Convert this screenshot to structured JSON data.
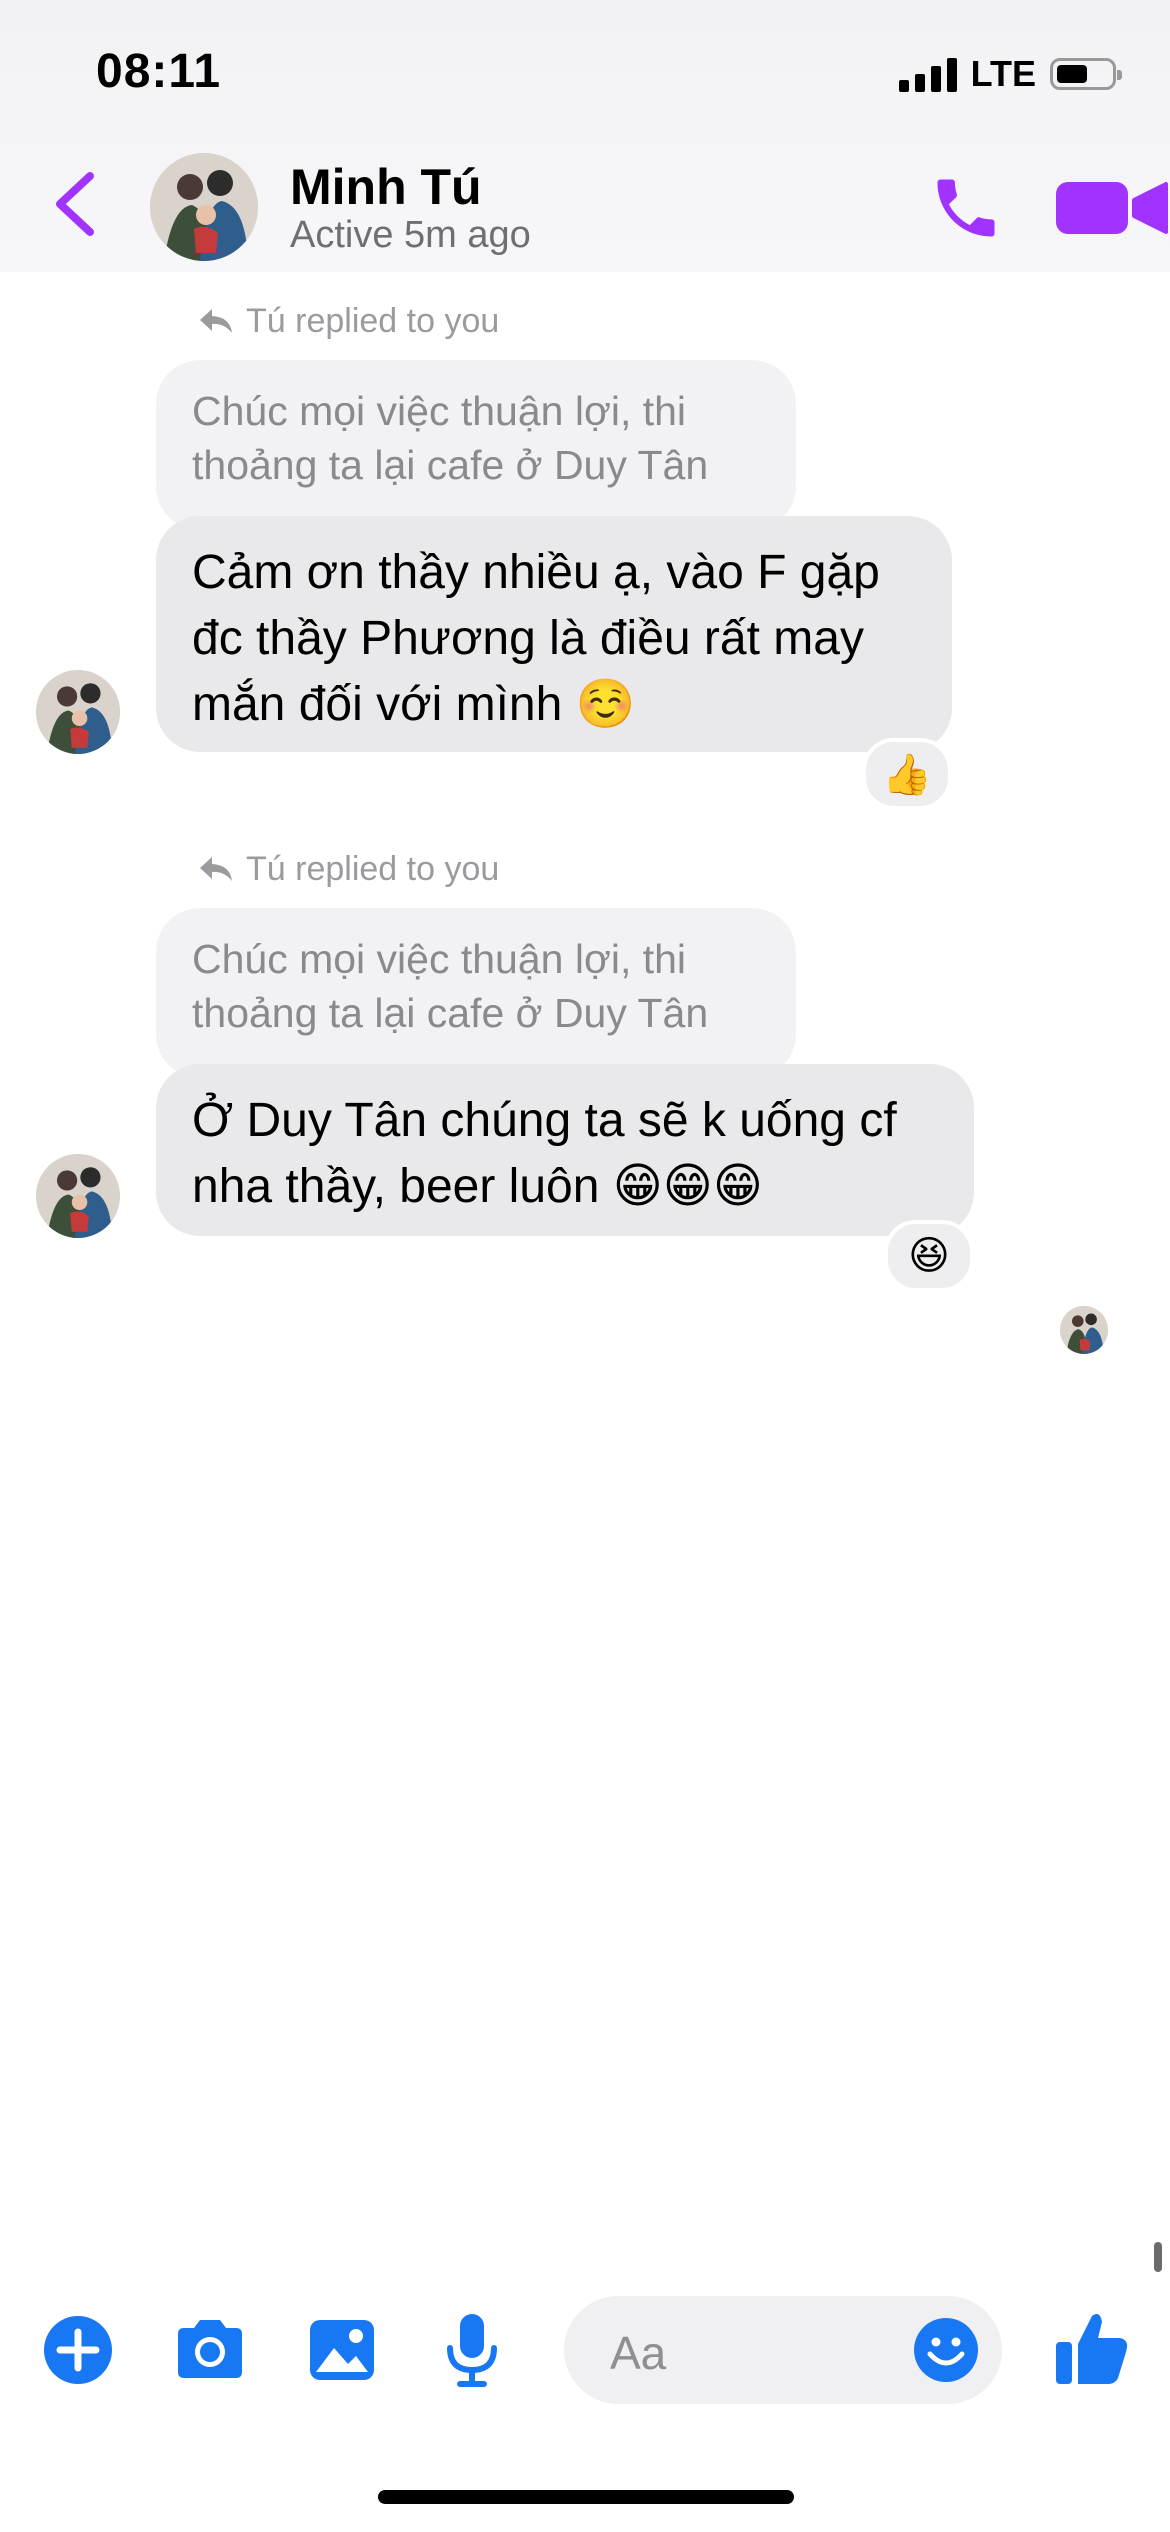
{
  "status_bar": {
    "time": "08:11",
    "network": "LTE",
    "battery_level": 0.55
  },
  "header": {
    "back_icon": "chevron-left-icon",
    "contact_name": "Minh Tú",
    "contact_status": "Active 5m ago",
    "call_icon": "phone-icon",
    "video_icon": "video-camera-icon",
    "accent_color": "#a033ff"
  },
  "messages": [
    {
      "reply_note": "Tú replied to you",
      "quoted_text": "Chúc mọi việc thuận lợi, thi thoảng ta lại cafe ở Duy Tân",
      "text": "Cảm ơn thầy nhiều ạ, vào F gặp đc thầy Phương là điều rất may mắn đối với mình ☺️",
      "reaction": "👍"
    },
    {
      "reply_note": "Tú replied to you",
      "quoted_text": "Chúc mọi việc thuận lợi, thi thoảng ta lại cafe ở Duy Tân",
      "text": "Ở Duy Tân chúng ta sẽ k uống cf nha thầy, beer luôn 😁😁😁",
      "reaction": "😆"
    }
  ],
  "composer": {
    "placeholder": "Aa",
    "icons": [
      "plus-circle-icon",
      "camera-icon",
      "photo-icon",
      "microphone-icon",
      "emoji-icon",
      "thumbs-up-icon"
    ],
    "icon_color": "#1877f2"
  }
}
